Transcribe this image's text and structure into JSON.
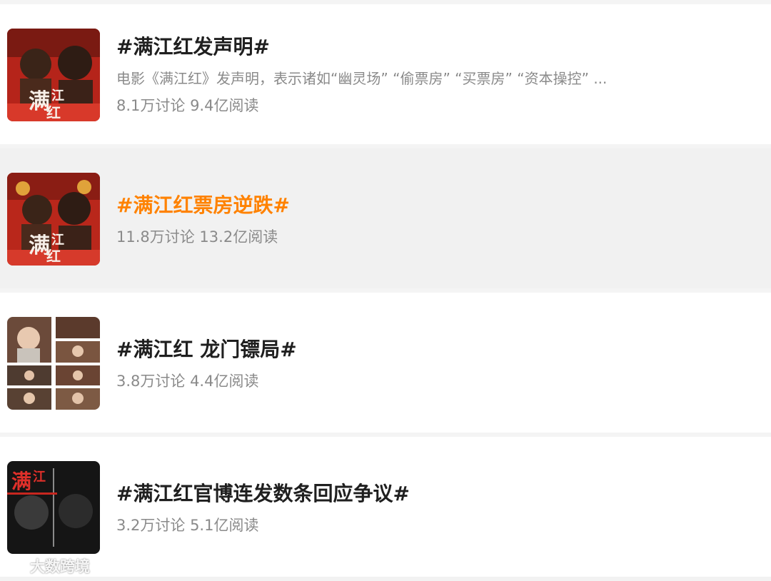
{
  "topics": [
    {
      "title": "#满江红发声明#",
      "description": "电影《满江红》发声明，表示诸如“幽灵场” “偷票房” “买票房” “资本操控” ...",
      "stats": "8.1万讨论 9.4亿阅读",
      "highlighted": false,
      "thumbnail": "movie-poster-red"
    },
    {
      "title": "#满江红票房逆跌#",
      "description": "",
      "stats": "11.8万讨论 13.2亿阅读",
      "highlighted": true,
      "thumbnail": "movie-poster-red"
    },
    {
      "title": "#满江红 龙门镖局#",
      "description": "",
      "stats": "3.8万讨论 4.4亿阅读",
      "highlighted": false,
      "thumbnail": "tv-drama-collage"
    },
    {
      "title": "#满江红官博连发数条回应争议#",
      "description": "",
      "stats": "3.2万讨论 5.1亿阅读",
      "highlighted": false,
      "thumbnail": "movie-poster-dark"
    }
  ],
  "watermark": "大数跨境",
  "colors": {
    "highlight_title": "#ff8200",
    "title": "#1f1f1f",
    "meta": "#8a8a8a",
    "highlight_bg": "#f1f1f1"
  }
}
